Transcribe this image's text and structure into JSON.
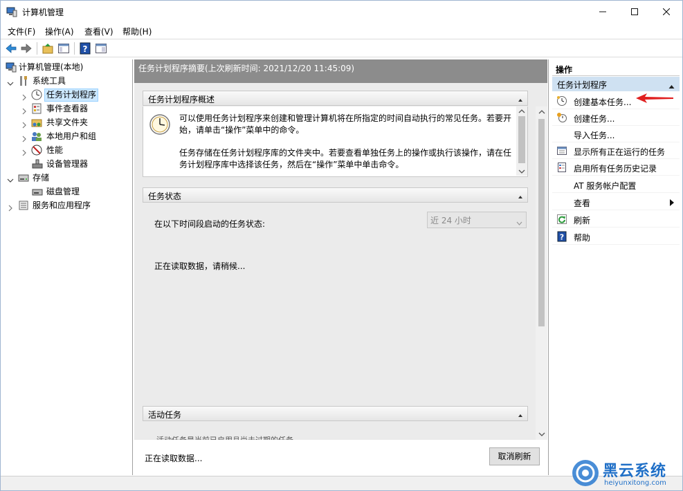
{
  "window": {
    "title": "计算机管理"
  },
  "menu": {
    "file": "文件(F)",
    "action": "操作(A)",
    "view": "查看(V)",
    "help": "帮助(H)"
  },
  "tree": {
    "root": "计算机管理(本地)",
    "system_tools": "系统工具",
    "task_scheduler": "任务计划程序",
    "event_viewer": "事件查看器",
    "shared_folders": "共享文件夹",
    "local_users": "本地用户和组",
    "performance": "性能",
    "device_manager": "设备管理器",
    "storage": "存储",
    "disk_management": "磁盘管理",
    "services_apps": "服务和应用程序"
  },
  "center": {
    "summary_header": "任务计划程序摘要(上次刷新时间: 2021/12/20 11:45:09)",
    "overview": {
      "title": "任务计划程序概述",
      "p1": "可以使用任务计划程序来创建和管理计算机将在所指定的时间自动执行的常见任务。若要开始，请单击“操作”菜单中的命令。",
      "p2": "任务存储在任务计划程序库的文件夹中。若要查看单独任务上的操作或执行该操作，请在任务计划程序库中选择该任务，然后在“操作”菜单中单击命令。"
    },
    "task_status": {
      "title": "任务状态",
      "label": "在以下时间段启动的任务状态:",
      "period": "近 24 小时",
      "reading": "正在读取数据，请稍候..."
    },
    "active_tasks": {
      "title": "活动任务",
      "desc": "活动任务是当前已启用且尚未过期的任务。"
    },
    "footer": {
      "status": "正在读取数据...",
      "cancel": "取消刷新"
    }
  },
  "actions": {
    "header": "操作",
    "group": "任务计划程序",
    "items": [
      "创建基本任务...",
      "创建任务...",
      "导入任务...",
      "显示所有正在运行的任务",
      "启用所有任务历史记录",
      "AT 服务帐户配置",
      "查看",
      "刷新",
      "帮助"
    ]
  },
  "watermark": {
    "name": "黑云系统",
    "url": "heiyunxitong.com"
  },
  "colors": {
    "accent": "#1f6fc7",
    "selection": "#cce8ff",
    "header_gray": "#8c8c8c",
    "arrow": "#e02020"
  }
}
